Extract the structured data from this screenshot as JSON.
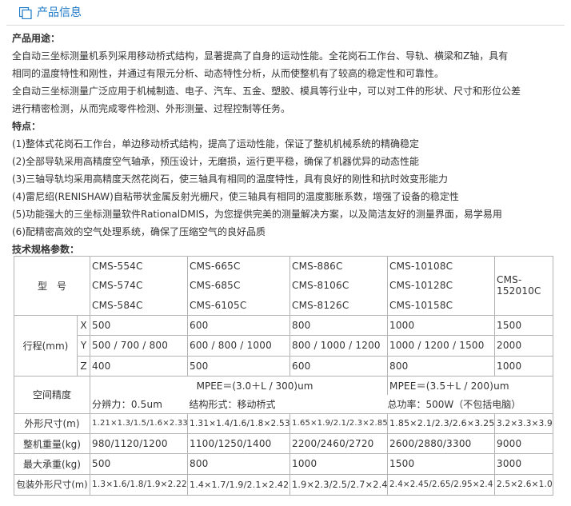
{
  "header": {
    "title": "产品信息",
    "icon": "square-stack-icon",
    "accent_color": "#1c79c7"
  },
  "usage": {
    "heading": "产品用途：",
    "lines": [
      "全自动三坐标测量机系列采用移动桥式结构，显著提高了自身的运动性能。全花岗石工作台、导轨、横梁和Z轴，具有",
      "相同的温度特性和刚性，并通过有限元分析、动态特性分析，从而使整机有了较高的稳定性和可靠性。",
      "全自动三坐标测量广泛应用于机械制造、电子、汽车、五金、塑胶、模具等行业中，可以对工件的形状、尺寸和形位公差",
      "进行精密检测，从而完成零件检测、外形测量、过程控制等任务。"
    ]
  },
  "features": {
    "heading": "特点：",
    "lines": [
      "(1)整体式花岗石工作台，单边移动桥式结构，提高了运动性能，保证了整机机械系统的精确稳定",
      "(2)全部导轨采用高精度空气轴承，预压设计，无磨损，运行更平稳，确保了机器优异的动态性能",
      "(3)三轴导轨均采用高精度天然花岗石，使三轴具有相同的温度特性，具有良好的刚性和抗时效变形能力",
      "(4)雷尼绍(RENISHAW)自粘带状金属反射光栅尺，使三轴具有相同的温度膨胀系数，增强了设备的稳定性",
      "(5)功能强大的三坐标测量软件RationalDMIS，为您提供完美的测量解决方案，以及简洁友好的测量界面，易学易用",
      "(6)配精密高效的空气处理系统，确保了压缩空气的良好品质"
    ]
  },
  "specs": {
    "heading": "技术规格参数：",
    "model_label": "型　号",
    "models": [
      [
        "CMS-554C",
        "CMS-665C",
        "CMS-886C",
        "CMS-10108C"
      ],
      [
        "CMS-574C",
        "CMS-685C",
        "CMS-8106C",
        "CMS-10128C"
      ],
      [
        "CMS-584C",
        "CMS-6105C",
        "CMS-8126C",
        "CMS-10158C"
      ]
    ],
    "model_last": [
      "CMS-",
      "152010C"
    ],
    "travel_label": "行程(mm)",
    "axes": [
      "X",
      "Y",
      "Z"
    ],
    "travel": [
      [
        "500",
        "600",
        "800",
        "1000",
        "1500"
      ],
      [
        "500 / 700 / 800",
        "600 / 800 / 1000",
        "800 / 1000 / 1200",
        "1000 / 1200 / 1500",
        "2000"
      ],
      [
        "400",
        "500",
        "600",
        "800",
        "1000"
      ]
    ],
    "accuracy_label": "空间精度",
    "mpee_left": "MPEE＝(3.0＋L / 300)um",
    "mpee_right": "MPEE＝(3.5＋L / 200)um",
    "resolution": "分辨力：0.5um",
    "structure": "结构形式：移动桥式",
    "power": "总功率：500W（不包括电脑）",
    "rows": [
      {
        "label": "外形尺寸(m)",
        "values": [
          "1.21×1.3/1.5/1.6×2.33",
          "1.31×1.4/1.6/1.8×2.53",
          "1.65×1.9/2.1/2.3×2.85",
          "1.85×2.1/2.3/2.6×3.25",
          "3.2×3.3×3.9"
        ]
      },
      {
        "label": "整机重量(kg)",
        "values": [
          "980/1120/1200",
          "1100/1250/1400",
          "2200/2460/2720",
          "2600/2880/3300",
          "9000"
        ]
      },
      {
        "label": "最大承重(kg)",
        "values": [
          "500",
          "800",
          "1000",
          "1500",
          "3000"
        ]
      },
      {
        "label": "包装外形尺寸(m)",
        "values": [
          "1.3×1.6/1.8/1.9×2.22",
          "1.4×1.7/1.9/2.1×2.42",
          "1.9×2.3/2.5/2.7×2.4",
          "2.4×2.45/2.65/2.95×2.4",
          "2.5×2.6×1.0"
        ]
      }
    ]
  }
}
